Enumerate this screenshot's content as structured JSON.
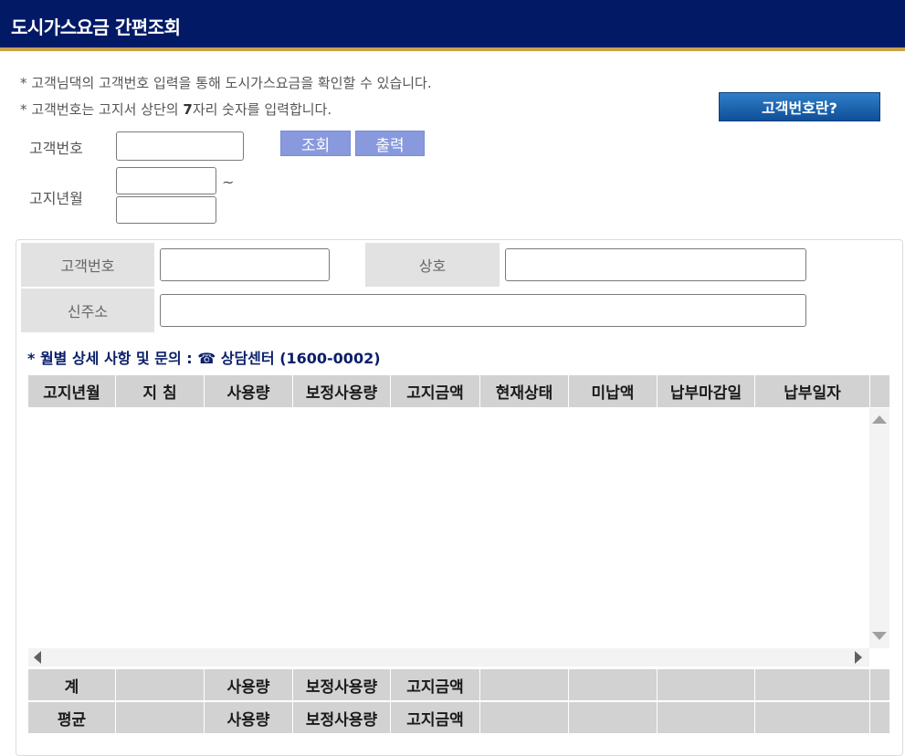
{
  "header": {
    "title": "도시가스요금 간편조회"
  },
  "notices": {
    "line1": "* 고객님댁의 고객번호 입력을 통해 도시가스요금을 확인할 수 있습니다.",
    "line2_prefix": "* 고객번호는 고지서 상단의 ",
    "line2_bold": "7",
    "line2_suffix": "자리 숫자를 입력합니다."
  },
  "help_button": "고객번호란?",
  "search": {
    "customer_no_label": "고객번호",
    "bill_month_label": "고지년월",
    "tilde": "~",
    "query_button": "조회",
    "print_button": "출력"
  },
  "info": {
    "customer_no_label": "고객번호",
    "company_label": "상호",
    "address_label": "신주소"
  },
  "inquiry": "* 월별 상세 사항 및 문의 : ☎ 상담센터 (1600-0002)",
  "table": {
    "headers": [
      "고지년월",
      "지 침",
      "사용량",
      "보정사용량",
      "고지금액",
      "현재상태",
      "미납액",
      "납부마감일",
      "납부일자",
      ""
    ],
    "total_row": [
      "계",
      "",
      "사용량",
      "보정사용량",
      "고지금액",
      "",
      "",
      "",
      "",
      ""
    ],
    "average_row": [
      "평균",
      "",
      "사용량",
      "보정사용량",
      "고지금액",
      "",
      "",
      "",
      "",
      ""
    ]
  }
}
